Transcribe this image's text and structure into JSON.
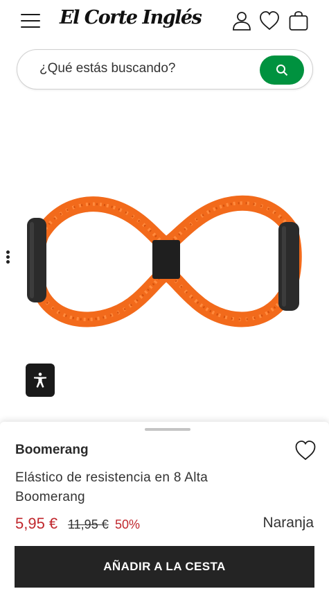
{
  "header": {
    "logo": "El Corte Inglés",
    "icons": [
      "menu-icon",
      "user-icon",
      "heart-icon",
      "bag-icon"
    ]
  },
  "search": {
    "placeholder": "¿Qué estás buscando?",
    "icon": "search-icon",
    "button_color": "#00923f"
  },
  "product": {
    "image_icon": "elastic-band-image",
    "brand": "Boomerang",
    "name": "Elástico de resistencia en 8 Alta Boomerang",
    "price": "5,95 €",
    "old_price": "11,95 €",
    "discount": "50%",
    "color": "Naranja",
    "price_color": "#c0272d"
  },
  "actions": {
    "add_to_cart": "AÑADIR A LA CESTA"
  }
}
